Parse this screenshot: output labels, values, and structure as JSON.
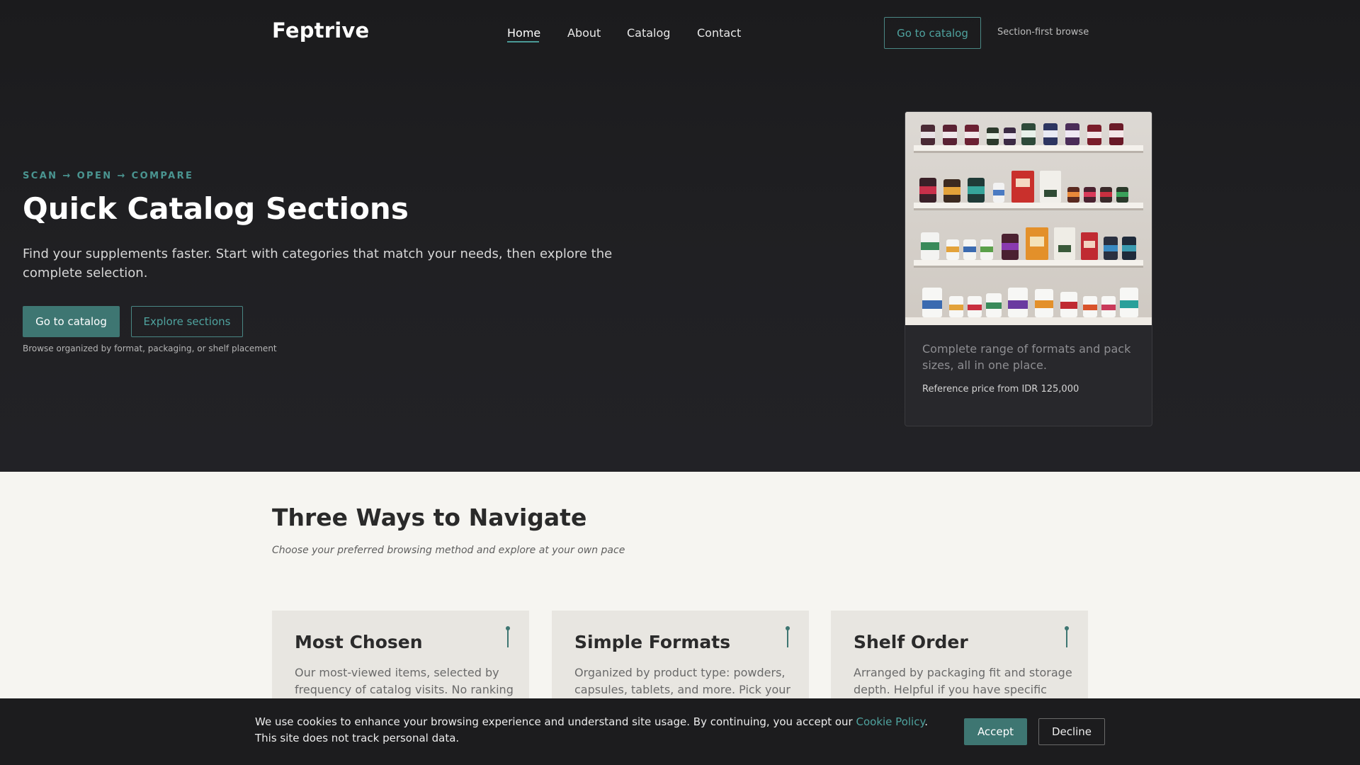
{
  "header": {
    "brand": "Feptrive",
    "nav": [
      {
        "label": "Home",
        "active": true
      },
      {
        "label": "About",
        "active": false
      },
      {
        "label": "Catalog",
        "active": false
      },
      {
        "label": "Contact",
        "active": false
      }
    ],
    "cta_label": "Go to catalog",
    "note": "Section-first browse"
  },
  "hero": {
    "eyebrow": "SCAN → OPEN → COMPARE",
    "title": "Quick Catalog Sections",
    "subtitle": "Find your supplements faster. Start with categories that match your needs, then explore the complete selection.",
    "primary_button": "Go to catalog",
    "secondary_button": "Explore sections",
    "note": "Browse organized by format, packaging, or shelf placement"
  },
  "product_card": {
    "image": "supplement-shelf-photo",
    "description": "Complete range of formats and pack sizes, all in one place.",
    "price": "Reference price from IDR 125,000"
  },
  "section": {
    "title": "Three Ways to Navigate",
    "subtitle": "Choose your preferred browsing method and explore at your own pace",
    "cards": [
      {
        "title": "Most Chosen",
        "text": "Our most-viewed items, selected by frequency of catalog visits. No ranking",
        "icon": "pin-icon"
      },
      {
        "title": "Simple Formats",
        "text": "Organized by product type: powders, capsules, tablets, and more. Pick your",
        "icon": "pin-icon"
      },
      {
        "title": "Shelf Order",
        "text": "Arranged by packaging fit and storage depth. Helpful if you have specific",
        "icon": "pin-icon"
      }
    ]
  },
  "cookie": {
    "text_before": "We use cookies to enhance your browsing experience and understand site usage. By continuing, you accept our ",
    "link": "Cookie Policy",
    "text_after": ". This site does not track personal data.",
    "accept": "Accept",
    "decline": "Decline"
  },
  "colors": {
    "accent": "#3e7672",
    "accent_text": "#4fa39f",
    "dark_bg": "#1f1f22",
    "light_bg": "#f6f5f1"
  }
}
